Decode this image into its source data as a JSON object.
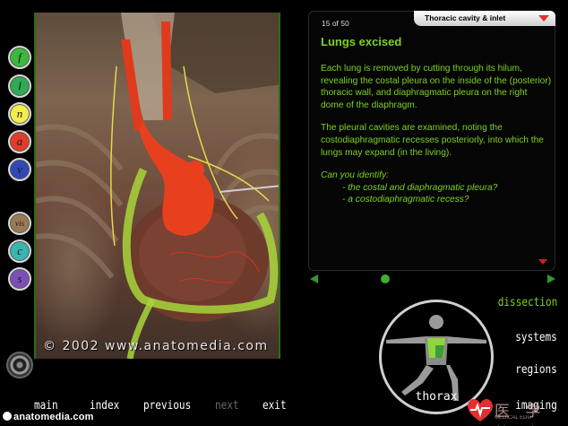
{
  "layer_buttons": [
    {
      "label": "f",
      "color": "#3db83d"
    },
    {
      "label": "l",
      "color": "#2faa55"
    },
    {
      "label": "n",
      "color": "#f2ef4a"
    },
    {
      "label": "a",
      "color": "#e23b2a"
    },
    {
      "label": "v",
      "color": "#2f48b8"
    },
    {
      "label": "vis",
      "color": "#9a7a55"
    },
    {
      "label": "c",
      "color": "#3ab5b0"
    },
    {
      "label": "s",
      "color": "#7c4fb8"
    }
  ],
  "photo": {
    "copyright": "© 2002 www.anatomedia.com"
  },
  "panel": {
    "counter": "15 of 50",
    "section": "Thoracic cavity & inlet",
    "title": "Lungs excised",
    "paragraph1": "Each lung is removed by cutting through its hilum, revealing the costal pleura on the inside of the (posterior) thoracic wall, and diaphragmatic pleura on the right dome of the diaphragm.",
    "paragraph2": "The pleural cavities are examined, noting the costodiaphragmatic recesses posteriorly, into which the lungs may expand (in the living).",
    "question_head": "Can you identify:",
    "question_items": [
      "- the costal and diaphragmatic pleura?",
      "- a costodiaphragmatic recess?"
    ]
  },
  "region_label": "thorax",
  "right_menu": {
    "dissection": "dissection",
    "systems": "systems",
    "regions": "regions",
    "imaging": "imaging"
  },
  "bottom_nav": {
    "main": "main",
    "index": "index",
    "previous": "previous",
    "next": "next",
    "exit": "exit"
  },
  "watermark": {
    "site": "anatomedia.com",
    "logo_cn": "医 学 教 育",
    "logo_sub": "MEDICAL EDU"
  },
  "colors": {
    "accent_green": "#7ed321",
    "pager_green": "#2e9b2e",
    "alert_red": "#d02020"
  }
}
